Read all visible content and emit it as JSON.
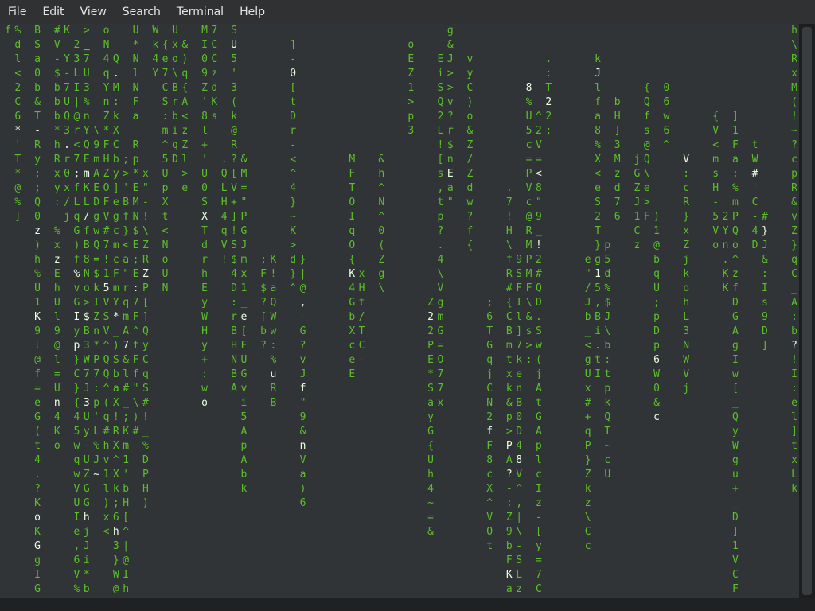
{
  "menu": [
    "File",
    "Edit",
    "View",
    "Search",
    "Terminal",
    "Help"
  ],
  "matrix_columns": [
    {
      "col": 0,
      "start": 0,
      "chars": "f"
    },
    {
      "col": 1,
      "start": 0,
      "chars": "%dl<2C6*'T*@%]"
    },
    {
      "col": 3,
      "start": 0,
      "chars": "BSa0b&T-Ry;;Q0z)h%U1K9l@f=eG(t4.?KoKGgIGar"
    },
    {
      "col": 5,
      "start": 0,
      "chars": "#V-$bbb*hRxy: %xzEhUl9@l=Un4Ko"
    },
    {
      "col": 6,
      "start": 0,
      "chars": "K Y-7UQ3.r0x/j"
    },
    {
      "col": 8,
      "start": 0,
      "chars": ">_7U3%nYQEmKL/fB8No>$B3W7J3Uy-UZGGhjJi*b(<"
    },
    {
      "col": 10,
      "start": 0,
      "chars": "oN4qYnZ*FHZOFV#7!15VSV^QQ^(q#hv1l)x<"
    },
    {
      "col": 13,
      "start": 0,
      "chars": "U*NlNFa\nRp*EMN$E;E:7F^fFf\"\\)#"
    },
    {
      "col": 15,
      "start": 0,
      "chars": "Wk4Y"
    },
    {
      "col": 17,
      "start": 0,
      "chars": "Uxo\\BrbiqD"
    },
    {
      "col": 20,
      "start": 0,
      "chars": "MI09Z'8l+'U0SXTdrhEyWHy+:wo"
    },
    {
      "col": 23,
      "start": 0,
      "chars": "SU5'3(k@R?[V+]!S$4D:rBHNBA"
    }
  ],
  "cursor_char": "I"
}
